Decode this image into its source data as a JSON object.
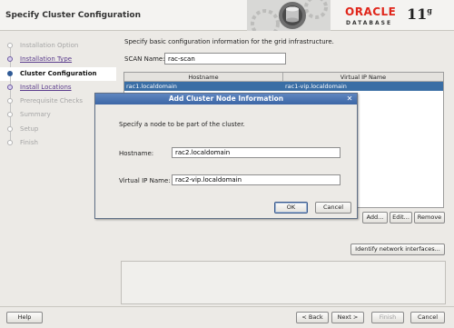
{
  "window": {
    "title": "Specify Cluster Configuration"
  },
  "brand": {
    "oracle": "ORACLE",
    "database": "DATABASE",
    "version": "11",
    "version_suffix": "g",
    "accent_color": "#e0261b"
  },
  "steps": [
    {
      "label": "Installation Option",
      "state": "done"
    },
    {
      "label": "Installation Type",
      "state": "link"
    },
    {
      "label": "Cluster Configuration",
      "state": "current"
    },
    {
      "label": "Install Locations",
      "state": "link"
    },
    {
      "label": "Prerequisite Checks",
      "state": "pending"
    },
    {
      "label": "Summary",
      "state": "pending"
    },
    {
      "label": "Setup",
      "state": "pending"
    },
    {
      "label": "Finish",
      "state": "pending"
    }
  ],
  "main": {
    "intro": "Specify basic configuration information for the grid infrastructure.",
    "scan_label": "SCAN Name:",
    "scan_value": "rac-scan",
    "table": {
      "headers": [
        "Hostname",
        "Virtual IP Name"
      ],
      "rows": [
        [
          "rac1.localdomain",
          "rac1-vip.localdomain"
        ]
      ],
      "selected_color": "#3a6ea5"
    },
    "add_button": "Add...",
    "edit_button": "Edit...",
    "remove_button": "Remove",
    "identify_button": "Identify network interfaces..."
  },
  "dialog": {
    "title": "Add Cluster Node Information",
    "close_glyph": "✕",
    "description": "Specify a node to be part of the cluster.",
    "hostname_label": "Hostname:",
    "hostname_value": "rac2.localdomain",
    "vip_label": "Virtual IP Name:",
    "vip_value": "rac2-vip.localdomain",
    "ok_button": "OK",
    "cancel_button": "Cancel"
  },
  "footer": {
    "help": "Help",
    "back": "< Back",
    "next": "Next >",
    "finish": "Finish",
    "cancel": "Cancel"
  }
}
